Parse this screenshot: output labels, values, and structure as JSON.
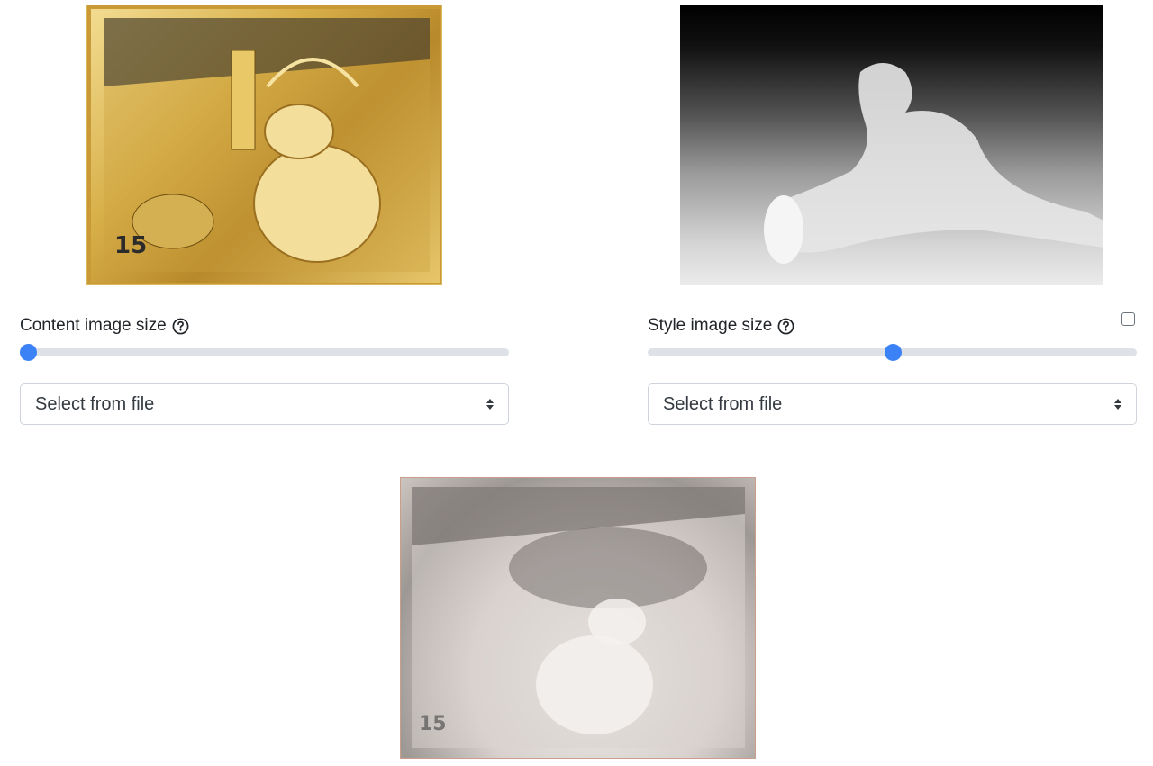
{
  "content": {
    "label": "Content image size",
    "slider_value": 0.0,
    "select_text": "Select from file"
  },
  "style": {
    "label": "Style image size",
    "slider_value": 0.5,
    "select_text": "Select from file",
    "checkbox_checked": false
  },
  "colors": {
    "accent": "#3b82f6",
    "track": "#dee2e6"
  },
  "icons": {
    "help": "question-circle-icon",
    "select_arrows": "chevron-up-down-icon"
  }
}
